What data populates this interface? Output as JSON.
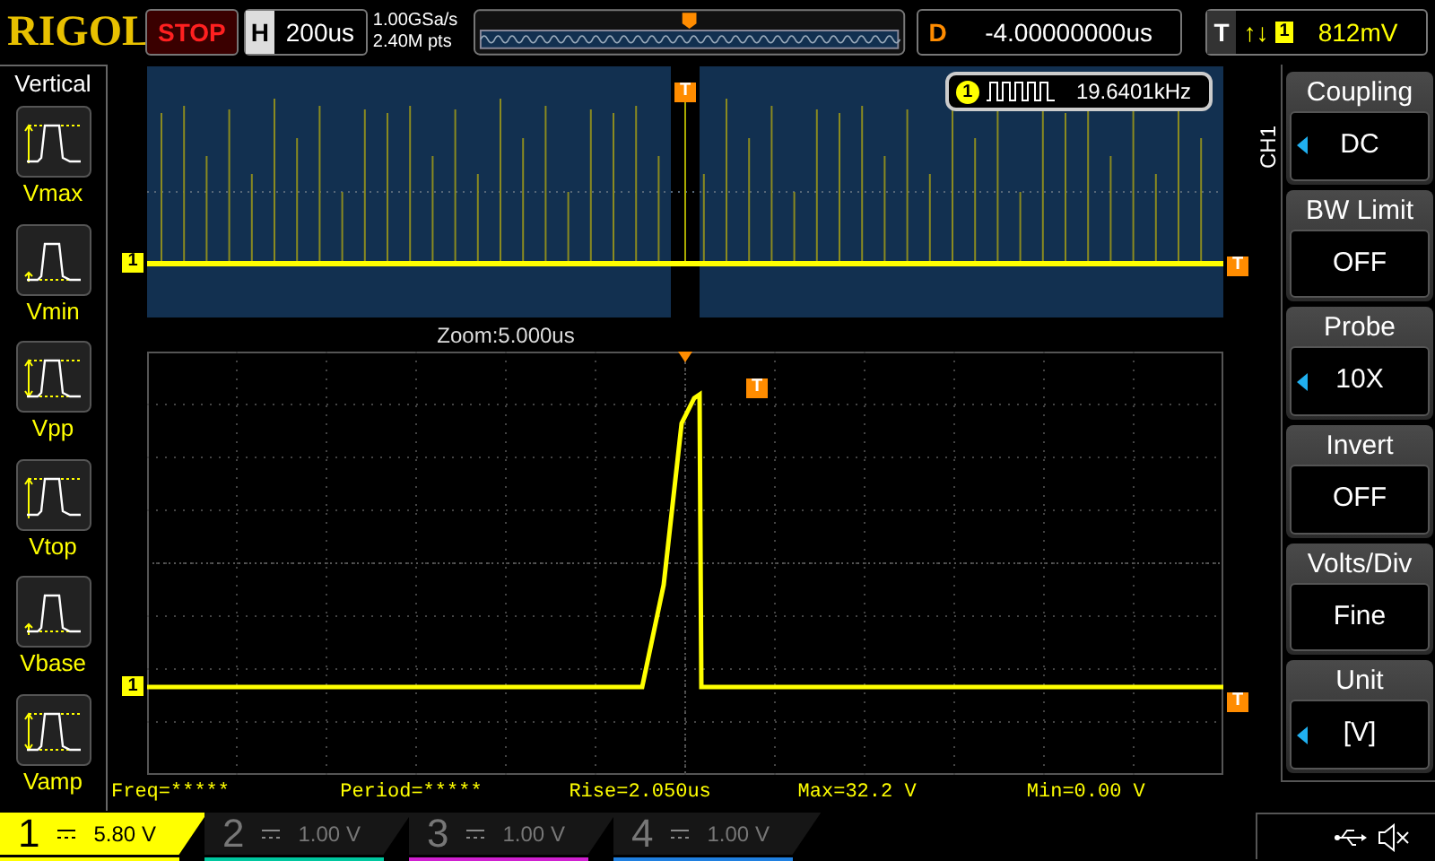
{
  "header": {
    "brand": "RIGOL",
    "run_state": "STOP",
    "timebase": {
      "label": "H",
      "value": "200us"
    },
    "sample_rate": "1.00GSa/s",
    "memory_depth": "2.40M pts",
    "delay": {
      "label": "D",
      "value": "-4.00000000us"
    },
    "trigger": {
      "label": "T",
      "slope": "↑↓",
      "source": "1",
      "level": "812mV"
    }
  },
  "measure_menu": {
    "title": "Vertical",
    "items": [
      {
        "label": "Vmax",
        "kind": "max"
      },
      {
        "label": "Vmin",
        "kind": "min"
      },
      {
        "label": "Vpp",
        "kind": "pp"
      },
      {
        "label": "Vtop",
        "kind": "top"
      },
      {
        "label": "Vbase",
        "kind": "base"
      },
      {
        "label": "Vamp",
        "kind": "amp"
      }
    ]
  },
  "overview": {
    "channel_marker": "1",
    "trigger_marker": "T",
    "level_marker": "T",
    "frequency": {
      "channel": "1",
      "value": "19.6401kHz"
    }
  },
  "zoom_label": "Zoom:5.000us",
  "main": {
    "channel_marker": "1",
    "trigger_marker": "T",
    "level_marker": "T"
  },
  "measurements": [
    "Freq=*****",
    "Period=*****",
    "Rise=2.050us",
    "Max=32.2 V",
    "Min=0.00 V"
  ],
  "channel_menu": {
    "side_label": "CH1",
    "items": [
      {
        "label": "Coupling",
        "value": "DC",
        "selector": true
      },
      {
        "label": "BW Limit",
        "value": "OFF",
        "selector": false
      },
      {
        "label": "Probe",
        "value": "10X",
        "selector": true
      },
      {
        "label": "Invert",
        "value": "OFF",
        "selector": false
      },
      {
        "label": "Volts/Div",
        "value": "Fine",
        "selector": false
      },
      {
        "label": "Unit",
        "value": "[V]",
        "selector": true
      }
    ]
  },
  "channels": [
    {
      "number": "1",
      "scale": "5.80 V",
      "selected": true,
      "color": "#ffff00"
    },
    {
      "number": "2",
      "scale": "1.00 V",
      "selected": false,
      "color": "#00c8a0"
    },
    {
      "number": "3",
      "scale": "1.00 V",
      "selected": false,
      "color": "#d020d0"
    },
    {
      "number": "4",
      "scale": "1.00 V",
      "selected": false,
      "color": "#2080e0"
    }
  ]
}
